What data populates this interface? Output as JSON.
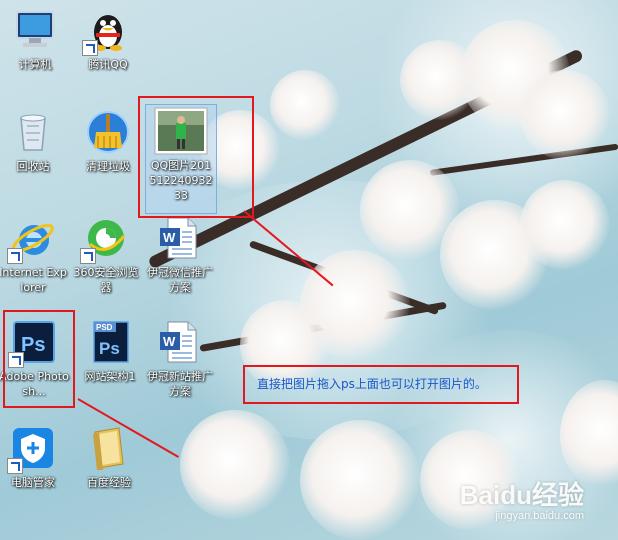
{
  "desktop": {
    "icons": [
      {
        "id": "computer",
        "label": "计算机"
      },
      {
        "id": "qq",
        "label": "腾讯QQ"
      },
      {
        "id": "recycle",
        "label": "回收站"
      },
      {
        "id": "cleaner",
        "label": "清理垃圾"
      },
      {
        "id": "photo",
        "label": "QQ图片20151224093233"
      },
      {
        "id": "ie",
        "label": "Internet Explorer"
      },
      {
        "id": "browser360",
        "label": "360安全浏览器"
      },
      {
        "id": "doc1",
        "label": "伊冠微信推广方案"
      },
      {
        "id": "photoshop",
        "label": "Adobe Photosh..."
      },
      {
        "id": "psd",
        "label": "网站架构1"
      },
      {
        "id": "doc2",
        "label": "伊冠新站推广方案"
      },
      {
        "id": "pcmanager",
        "label": "电脑管家"
      },
      {
        "id": "folder",
        "label": "百度经验"
      }
    ]
  },
  "annotation": {
    "note": "直接把图片拖入ps上面也可以打开图片的。",
    "color": "#e3181f",
    "text_color": "#1a57c9"
  },
  "watermark": {
    "brand": "Baidu经验",
    "url": "jingyan.baidu.com"
  }
}
